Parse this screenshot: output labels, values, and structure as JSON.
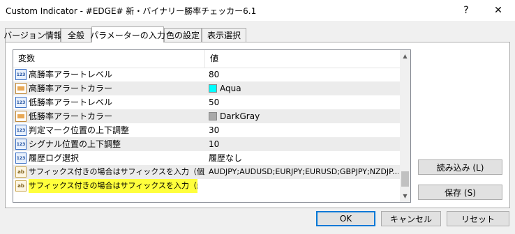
{
  "window": {
    "title": "Custom Indicator - #EDGE# 新・バイナリー勝率チェッカー6.1",
    "help_glyph": "?",
    "close_glyph": "✕"
  },
  "tabs": [
    {
      "label": "バージョン情報",
      "active": false
    },
    {
      "label": "全般",
      "active": false
    },
    {
      "label": "パラメーターの入力",
      "active": true
    },
    {
      "label": "色の設定",
      "active": false
    },
    {
      "label": "表示選択",
      "active": false
    }
  ],
  "table": {
    "headers": {
      "variable": "変数",
      "value": "値"
    },
    "rows": [
      {
        "icon": "numeric-icon",
        "name": "高勝率アラートレベル",
        "value": "80"
      },
      {
        "icon": "color-icon",
        "name": "高勝率アラートカラー",
        "value": "Aqua",
        "swatch": "#00ffff"
      },
      {
        "icon": "numeric-icon",
        "name": "低勝率アラートレベル",
        "value": "50"
      },
      {
        "icon": "color-icon",
        "name": "低勝率アラートカラー",
        "value": "DarkGray",
        "swatch": "#a9a9a9"
      },
      {
        "icon": "numeric-icon",
        "name": "判定マーク位置の上下調整",
        "value": "30"
      },
      {
        "icon": "numeric-icon",
        "name": "シグナル位置の上下調整",
        "value": "10"
      },
      {
        "icon": "numeric-icon",
        "name": "履歴ログ選択",
        "value": "履歴なし"
      },
      {
        "icon": "string-icon",
        "name": "サフィックス付きの場合はサフィックスを入力（個別）",
        "value": "AUDJPY;AUDUSD;EURJPY;EURUSD;GBPJPY;NZDJP..."
      },
      {
        "icon": "string-icon",
        "name": "サフィックス付きの場合はサフィックスを入力（総合）",
        "value": "",
        "highlight": true
      }
    ],
    "icon_glyphs": {
      "numeric": "123",
      "string": "ab"
    }
  },
  "scrollbar": {
    "up": "▲",
    "down": "▼"
  },
  "side_buttons": {
    "load": "読み込み (L)",
    "save": "保存 (S)"
  },
  "footer_buttons": {
    "ok": "OK",
    "cancel": "キャンセル",
    "reset": "リセット"
  }
}
